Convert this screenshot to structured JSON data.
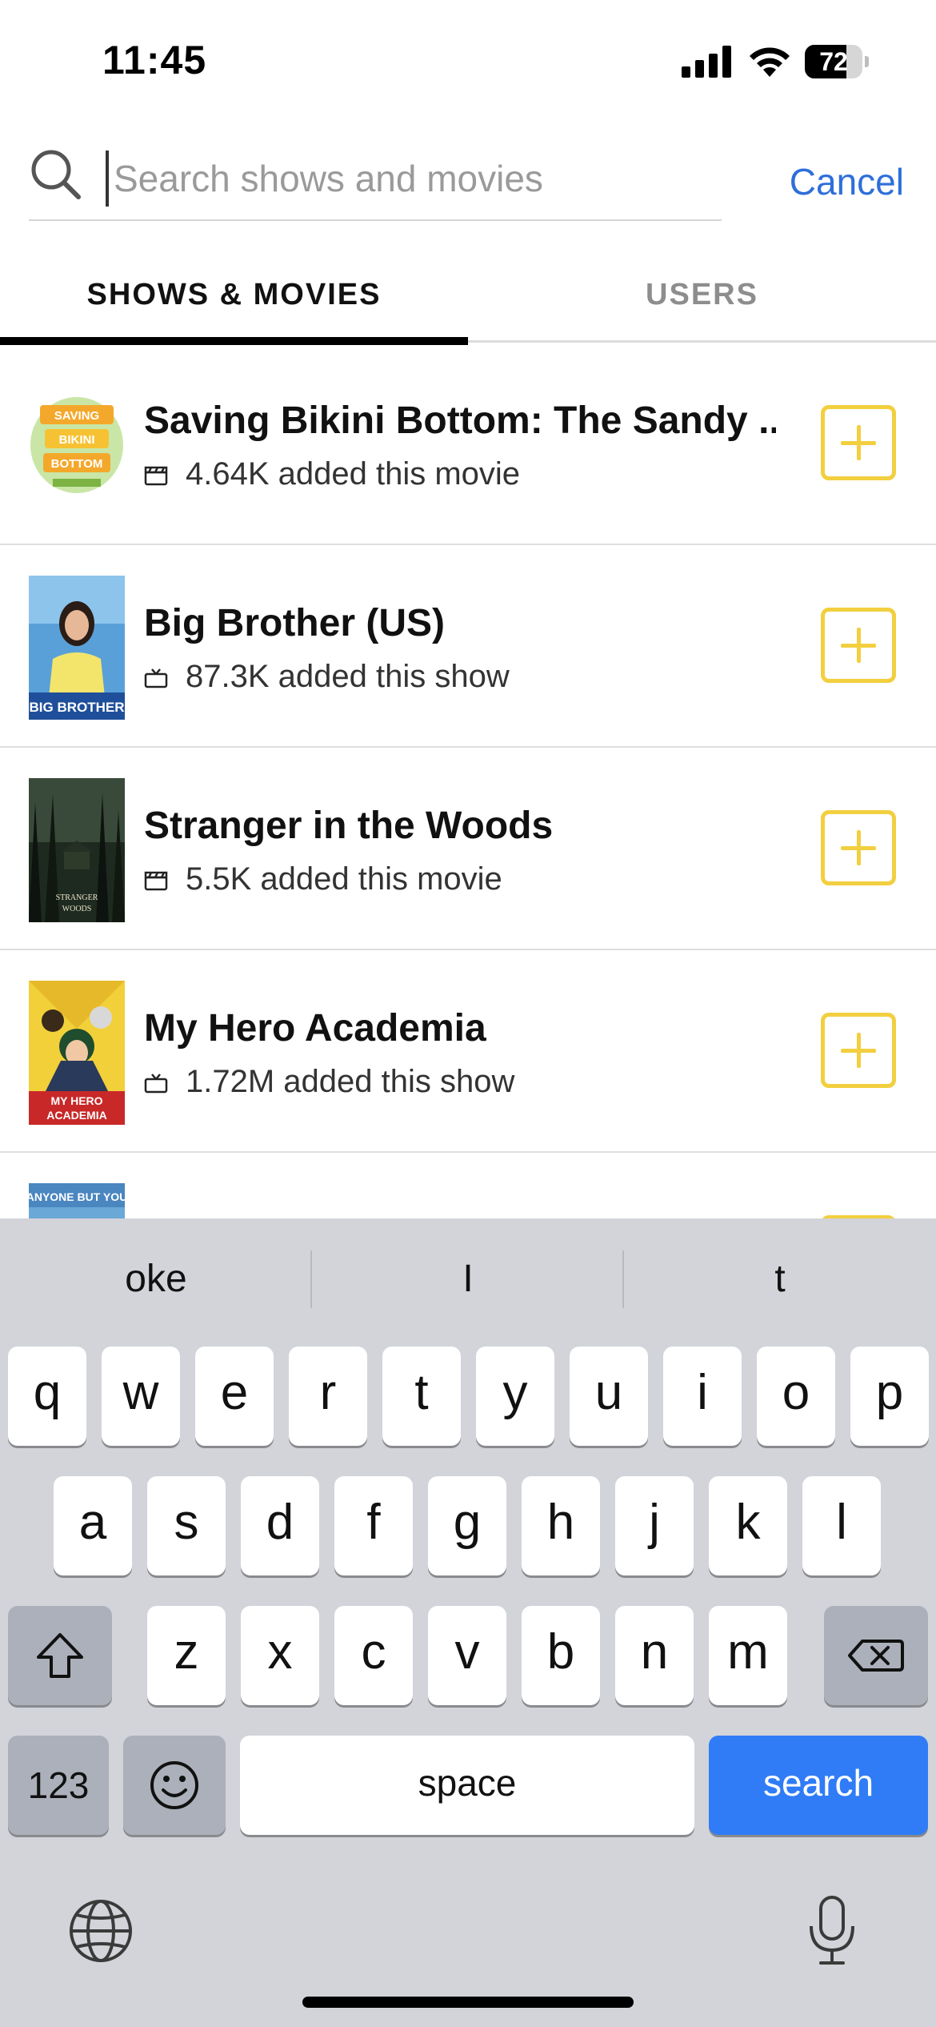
{
  "status_bar": {
    "time": "11:45",
    "battery_level": "72",
    "battery_fraction": 0.72
  },
  "search": {
    "placeholder": "Search shows and movies",
    "value": "",
    "cancel_label": "Cancel"
  },
  "tabs": [
    {
      "label": "SHOWS & MOVIES",
      "active": true
    },
    {
      "label": "USERS",
      "active": false
    }
  ],
  "results": [
    {
      "title": "Saving Bikini Bottom: The Sandy ...",
      "meta": "4.64K added this movie",
      "kind_icon": "clapperboard-icon",
      "poster_text": "SAVING BIKINI BOTTOM"
    },
    {
      "title": "Big Brother (US)",
      "meta": "87.3K added this show",
      "kind_icon": "tv-icon",
      "poster_text": "BIG BROTHER"
    },
    {
      "title": "Stranger in the Woods",
      "meta": "5.5K added this movie",
      "kind_icon": "clapperboard-icon",
      "poster_text": "STRANGER IN THE WOODS"
    },
    {
      "title": "My Hero Academia",
      "meta": "1.72M added this show",
      "kind_icon": "tv-icon",
      "poster_text": "MY HERO ACADEMIA"
    },
    {
      "title": "",
      "meta": "",
      "kind_icon": "tv-icon",
      "poster_text": "ANYONE BUT YOU"
    }
  ],
  "keyboard": {
    "suggestions": [
      "oke",
      "I",
      "t"
    ],
    "row1": [
      "q",
      "w",
      "e",
      "r",
      "t",
      "y",
      "u",
      "i",
      "o",
      "p"
    ],
    "row2": [
      "a",
      "s",
      "d",
      "f",
      "g",
      "h",
      "j",
      "k",
      "l"
    ],
    "row3": [
      "z",
      "x",
      "c",
      "v",
      "b",
      "n",
      "m"
    ],
    "numbers_label": "123",
    "space_label": "space",
    "search_label": "search"
  },
  "colors": {
    "accent_blue": "#2e6fd9",
    "add_yellow": "#f2cf3f",
    "keyboard_bg": "#d2d4da",
    "search_key_blue": "#2f7cf6"
  }
}
